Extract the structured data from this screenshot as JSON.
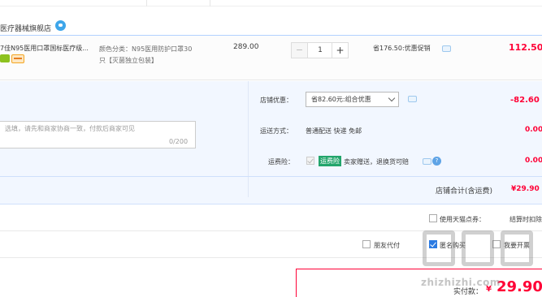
{
  "shop": {
    "name": "医疗器械旗舰店",
    "chat_icon": "wangwang-chat-icon"
  },
  "item": {
    "title": "7佳N95医用口罩国标医疗级...",
    "sku_line1": "颜色分类：N95医用防护口罩30",
    "sku_line2": "只【灭菌独立包装】",
    "price": "289.00",
    "quantity": "1",
    "minus": "−",
    "plus": "+",
    "discount": "省176.50:优惠促销",
    "subtotal": "112.50"
  },
  "message": {
    "placeholder": "选填，请先和商家协商一致，付款后商家可见",
    "counter": "0/200"
  },
  "shop_discount": {
    "label": "店铺优惠：",
    "selected": "省82.60元:组合优惠",
    "amount": "-82.60"
  },
  "shipping": {
    "label": "运送方式：",
    "value": "普通配送 快递 免邮",
    "amount": "0.00"
  },
  "insurance": {
    "label": "运费险：",
    "tag": "运费险",
    "desc": "卖家赠送，退换货可赔",
    "amount": "0.00",
    "help": "?"
  },
  "shop_total": {
    "label": "店铺合计(含运费)",
    "value": "¥29.90"
  },
  "points": {
    "label": "使用天猫点券：",
    "extra": "结算时扣除"
  },
  "options": {
    "friend_pay": "朋友代付",
    "anonymous": "匿名购买",
    "gift": "我要开票"
  },
  "payment": {
    "label": "实付款：",
    "currency": "¥",
    "value": "29.90"
  },
  "watermark": {
    "text": "zhizhizhi.com"
  },
  "colors": {
    "accent": "#ff0036",
    "panel": "#f2f7ff",
    "link": "#2a7ae2"
  }
}
